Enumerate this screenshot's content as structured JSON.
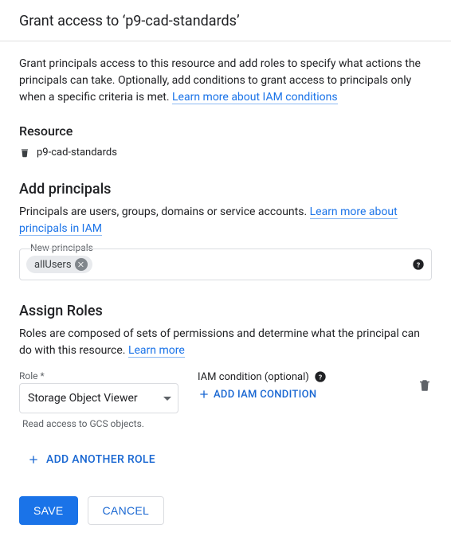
{
  "header": {
    "title": "Grant access to ‘p9-cad-standards’"
  },
  "intro": {
    "text": "Grant principals access to this resource and add roles to specify what actions the principals can take. Optionally, add conditions to grant access to principals only when a specific criteria is met. ",
    "link": "Learn more about IAM conditions"
  },
  "resource": {
    "heading": "Resource",
    "name": "p9-cad-standards"
  },
  "principals": {
    "heading": "Add principals",
    "desc_prefix": "Principals are users, groups, domains or service accounts. ",
    "desc_link": "Learn more about principals in IAM",
    "field_label": "New principals",
    "chip_value": "allUsers"
  },
  "roles": {
    "heading": "Assign Roles",
    "desc_prefix": "Roles are composed of sets of permissions and determine what the principal can do with this resource. ",
    "desc_link": "Learn more",
    "role_label": "Role *",
    "role_value": "Storage Object Viewer",
    "role_desc": "Read access to GCS objects.",
    "iam_label": "IAM condition (optional)",
    "add_condition_label": "ADD IAM CONDITION",
    "add_another_label": "ADD ANOTHER ROLE"
  },
  "actions": {
    "save": "SAVE",
    "cancel": "CANCEL"
  }
}
